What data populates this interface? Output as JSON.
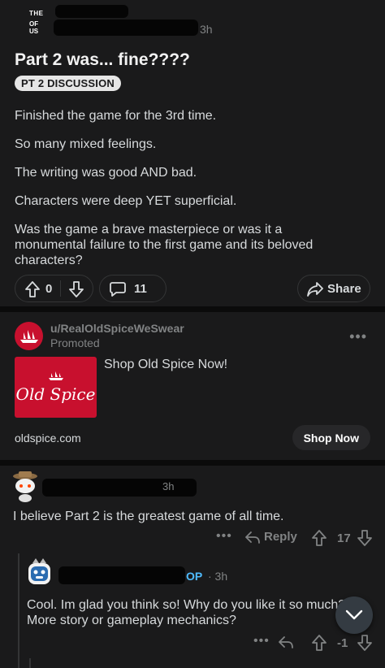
{
  "post": {
    "subreddit_icon_top": "THE",
    "subreddit_icon_bottom": "OF US",
    "time": "3h",
    "title": "Part 2 was... fine????",
    "flair": "PT 2 DISCUSSION",
    "body": [
      "Finished the game for the 3rd time.",
      "So many mixed feelings.",
      "The writing was good AND bad.",
      "Characters were deep YET superficial.",
      "Was the game a brave masterpiece or was it a monumental failure to the first game and its beloved characters?"
    ],
    "score": "0",
    "comments": "11",
    "share_label": "Share"
  },
  "ad": {
    "username": "u/RealOldSpiceWeSwear",
    "promoted": "Promoted",
    "menu": "•••",
    "brand": "Old Spice",
    "headline": "Shop Old Spice Now!",
    "domain": "oldspice.com",
    "cta": "Shop Now"
  },
  "comment": {
    "time": "3h",
    "text": "I believe Part 2 is the greatest game of all time.",
    "more": "•••",
    "reply_label": "Reply",
    "score": "17"
  },
  "reply": {
    "op_tag": "OP",
    "time": "· 3h",
    "text_line1": "Cool. Im glad you think so! Why do you like it so much?",
    "text_line2": "More story or gameplay mechanics?",
    "more": "•••",
    "score": "-1"
  },
  "colors": {
    "background": "#0b0b0b",
    "card": "#1a1a1b",
    "op_blue": "#4fbcff",
    "old_spice_red": "#c8102e"
  }
}
